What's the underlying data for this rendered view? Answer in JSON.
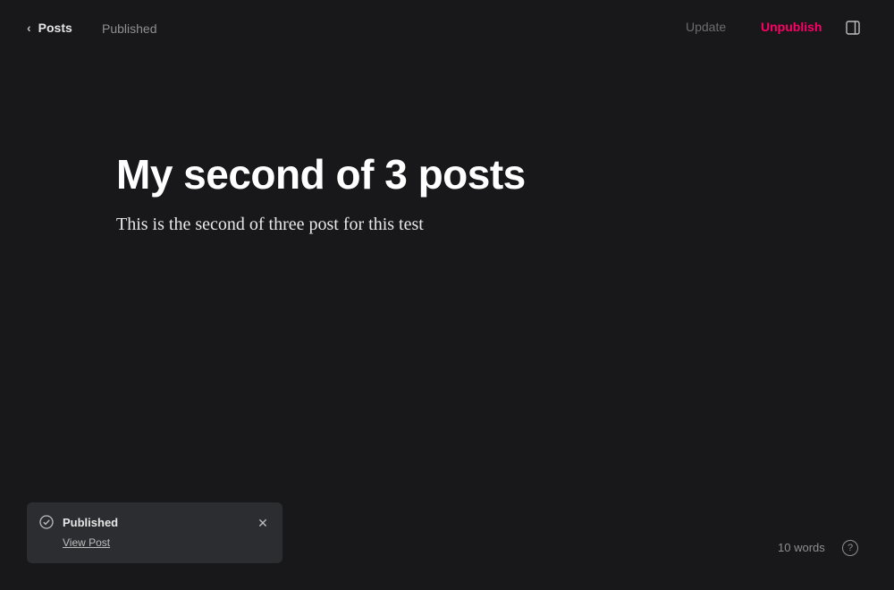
{
  "topbar": {
    "back_label": "Posts",
    "status": "Published",
    "update_label": "Update",
    "unpublish_label": "Unpublish"
  },
  "post": {
    "title": "My second of 3 posts",
    "body": "This is the second of three post for this test"
  },
  "toast": {
    "title": "Published",
    "link": "View Post"
  },
  "footer": {
    "word_count": "10 words",
    "help_label": "?"
  },
  "icons": {
    "back": "chevron-left-icon",
    "sidebar": "sidebar-toggle-icon",
    "toast": "published-check-icon",
    "close": "close-icon",
    "help": "help-icon"
  },
  "colors": {
    "background": "#18181b",
    "accent": "#ff0066",
    "toast_background": "#2c2d31",
    "muted": "#8e8e93"
  }
}
